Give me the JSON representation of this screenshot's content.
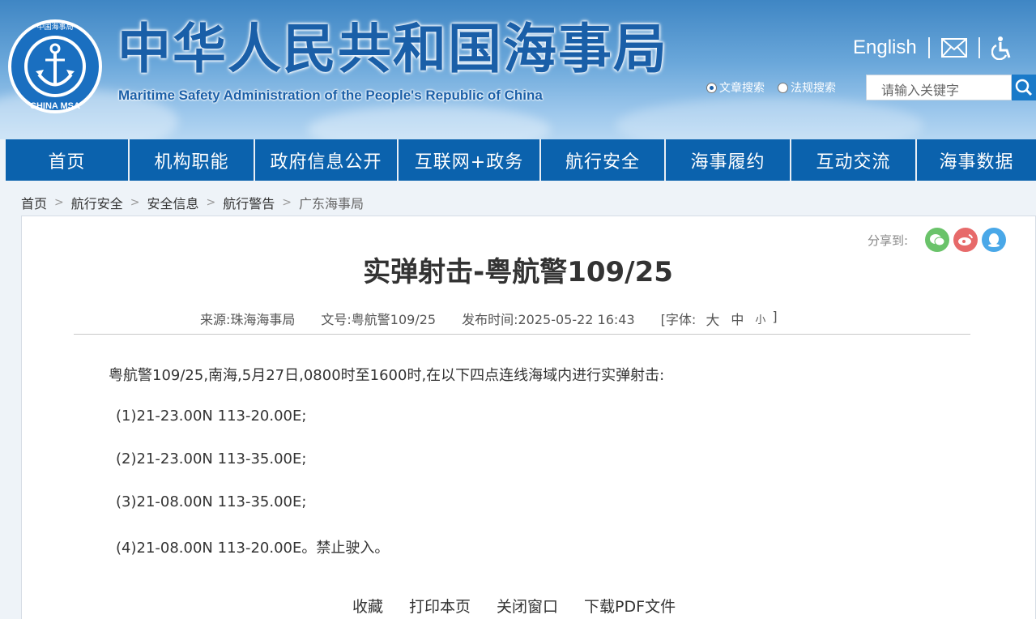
{
  "header": {
    "title_cn": "中华人民共和国海事局",
    "title_en": "Maritime Safety Administration of the People's Republic of China",
    "logo_text_top": "中国海事局",
    "logo_text_bottom": "CHINA MSA",
    "english_link": "English",
    "search_option_article": "文章搜索",
    "search_option_law": "法规搜索",
    "search_placeholder": "请输入关键字",
    "icons": [
      "mail-icon",
      "accessibility-icon",
      "search-icon"
    ]
  },
  "nav": {
    "items": [
      "首页",
      "机构职能",
      "政府信息公开",
      "互联网+政务",
      "航行安全",
      "海事履约",
      "互动交流",
      "海事数据"
    ]
  },
  "breadcrumb": {
    "items": [
      "首页",
      "航行安全",
      "安全信息",
      "航行警告",
      "广东海事局"
    ],
    "separator": ">"
  },
  "share": {
    "label": "分享到:",
    "icons": [
      "wechat-icon",
      "weibo-icon",
      "qq-icon"
    ]
  },
  "article": {
    "title": "实弹射击-粤航警109/25",
    "source": "来源:珠海海事局",
    "doc_no": "文号:粤航警109/25",
    "publish_time": "发布时间:2025-05-22 16:43",
    "font_label": "[字体:",
    "font_large": "大",
    "font_medium": "中",
    "font_small": "小",
    "font_close": "]",
    "paragraphs": [
      "粤航警109/25,南海,5月27日,0800时至1600时,在以下四点连线海域内进行实弹射击:",
      "(1)21-23.00N 113-20.00E;",
      "(2)21-23.00N 113-35.00E;",
      "(3)21-08.00N 113-35.00E;",
      "(4)21-08.00N 113-20.00E。禁止驶入。"
    ]
  },
  "footer_links": [
    "收藏",
    "打印本页",
    "关闭窗口",
    "下载PDF文件"
  ],
  "colors": {
    "brand_blue": "#0b62ad",
    "title_blue": "#1a5fa8",
    "wechat_green": "#6ac36a",
    "weibo_red": "#e76a6a",
    "qq_blue": "#4aa8e8"
  }
}
